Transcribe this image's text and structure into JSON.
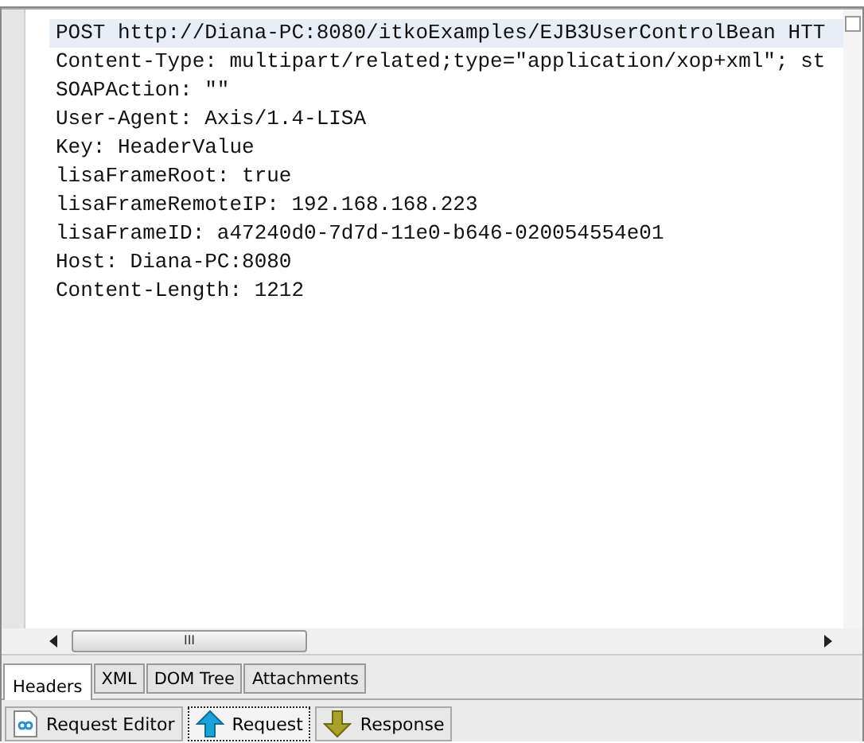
{
  "editor": {
    "lines": [
      {
        "text": "POST http://Diana-PC:8080/itkoExamples/EJB3UserControlBean HTT",
        "highlighted": true
      },
      {
        "text": "Content-Type: multipart/related;type=\"application/xop+xml\"; st",
        "highlighted": false
      },
      {
        "text": "SOAPAction: \"\"",
        "highlighted": false
      },
      {
        "text": "User-Agent: Axis/1.4-LISA",
        "highlighted": false
      },
      {
        "text": "Key: HeaderValue",
        "highlighted": false
      },
      {
        "text": "lisaFrameRoot: true",
        "highlighted": false
      },
      {
        "text": "lisaFrameRemoteIP: 192.168.168.223",
        "highlighted": false
      },
      {
        "text": "lisaFrameID: a47240d0-7d7d-11e0-b646-020054554e01",
        "highlighted": false
      },
      {
        "text": "Host: Diana-PC:8080",
        "highlighted": false
      },
      {
        "text": "Content-Length: 1212",
        "highlighted": false
      }
    ]
  },
  "scrollbar": {
    "grip": "III"
  },
  "view_tabs": [
    {
      "label": "Headers",
      "selected": true
    },
    {
      "label": "XML",
      "selected": false
    },
    {
      "label": "DOM Tree",
      "selected": false
    },
    {
      "label": "Attachments",
      "selected": false
    }
  ],
  "bottom_tabs": [
    {
      "label": "Request Editor",
      "kind": "editor",
      "selected": false
    },
    {
      "label": "Request",
      "kind": "up",
      "selected": true
    },
    {
      "label": "Response",
      "kind": "down",
      "selected": false
    }
  ]
}
